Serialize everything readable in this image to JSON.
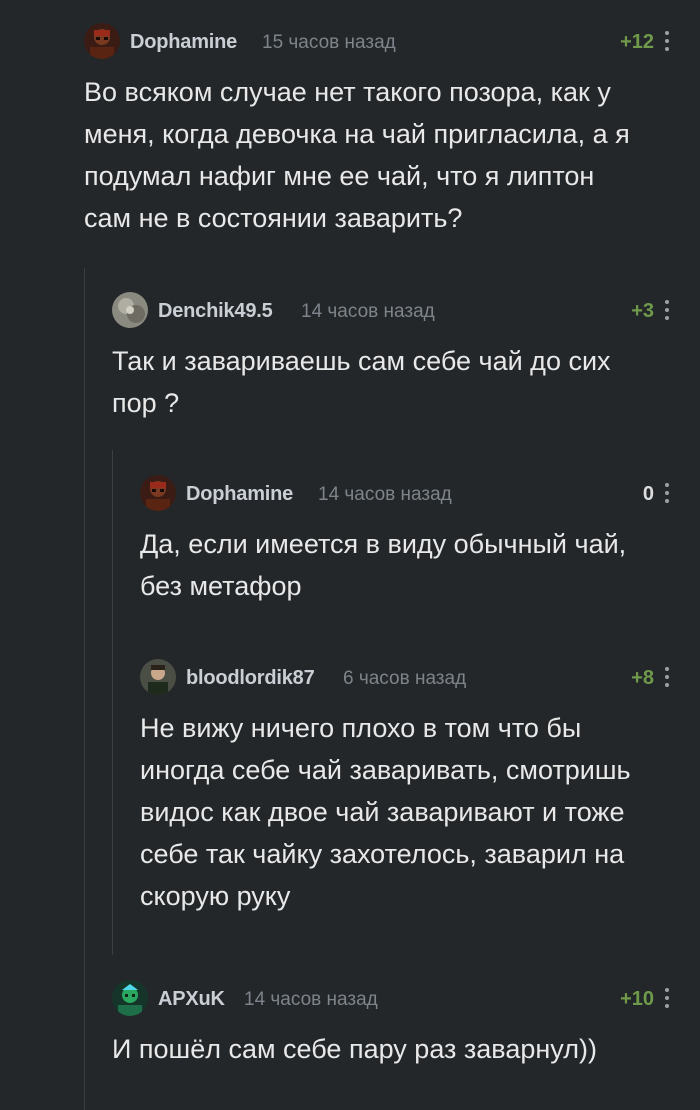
{
  "comments": [
    {
      "username": "Dophamine",
      "time": "15 часов назад",
      "rating": "+12",
      "text": "Во всяком случае нет такого позора, как у\nменя, когда девочка на чай пригласила, а я\nподумал нафиг мне ее чай, что я липтон\nсам не в состоянии заварить?"
    },
    {
      "username": "Denchik49.5",
      "time": "14 часов назад",
      "rating": "+3",
      "text": "Так и завариваешь сам себе чай до сих\nпор ?"
    },
    {
      "username": "Dophamine",
      "time": "14 часов назад",
      "rating": "0",
      "text": "Да, если имеется в виду обычный чай,\nбез метафор"
    },
    {
      "username": "bloodlordik87",
      "time": "6 часов назад",
      "rating": "+8",
      "text": "Не вижу ничего плохо в том что бы\nиногда себе чай заваривать, смотришь\nвидос как двое чай заваривают и тоже\nсебе так чайку захотелось, заварил на\nскорую руку"
    },
    {
      "username": "APXuK",
      "time": "14 часов назад",
      "rating": "+10",
      "text": "И пошёл сам себе пару раз заварнул))"
    }
  ],
  "colors": {
    "background": "#23272a",
    "username": "#c9cfd4",
    "time": "#7d848a",
    "rating_positive": "#6f9a4b",
    "rating_zero": "#dcdcdc",
    "thread_line": "#3a3f44"
  },
  "icons": {
    "menu": "more-vertical-icon"
  }
}
